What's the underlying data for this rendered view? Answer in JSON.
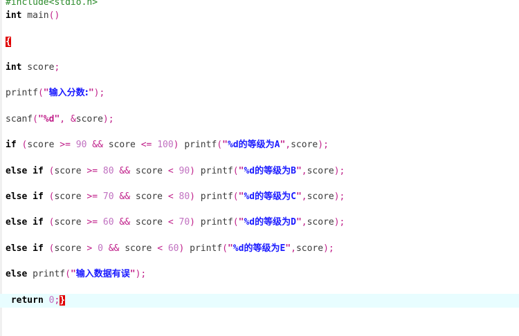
{
  "editor": {
    "lines": [
      [
        {
          "t": "prep",
          "s": "#include<stdio.h>"
        }
      ],
      [
        {
          "t": "kw",
          "s": "int"
        },
        {
          "t": "plain",
          "s": " main"
        },
        {
          "t": "op",
          "s": "()"
        }
      ],
      [
        {
          "t": "brace",
          "s": "{"
        }
      ],
      [
        {
          "t": "kw",
          "s": "int"
        },
        {
          "t": "plain",
          "s": " score"
        },
        {
          "t": "op",
          "s": ";"
        }
      ],
      [
        {
          "t": "plain",
          "s": "printf"
        },
        {
          "t": "op",
          "s": "("
        },
        {
          "t": "str",
          "s": "\""
        },
        {
          "t": "cjk",
          "s": "输入分数:"
        },
        {
          "t": "str",
          "s": "\""
        },
        {
          "t": "op",
          "s": ");"
        }
      ],
      [
        {
          "t": "plain",
          "s": "scanf"
        },
        {
          "t": "op",
          "s": "("
        },
        {
          "t": "str",
          "s": "\"%d\""
        },
        {
          "t": "op",
          "s": ","
        },
        {
          "t": "plain",
          "s": " "
        },
        {
          "t": "op",
          "s": "&"
        },
        {
          "t": "plain",
          "s": "score"
        },
        {
          "t": "op",
          "s": ");"
        }
      ],
      [
        {
          "t": "kw",
          "s": "if"
        },
        {
          "t": "plain",
          "s": " "
        },
        {
          "t": "op",
          "s": "("
        },
        {
          "t": "plain",
          "s": "score "
        },
        {
          "t": "op",
          "s": ">="
        },
        {
          "t": "plain",
          "s": " "
        },
        {
          "t": "num",
          "s": "90"
        },
        {
          "t": "plain",
          "s": " "
        },
        {
          "t": "op",
          "s": "&&"
        },
        {
          "t": "plain",
          "s": " score "
        },
        {
          "t": "op",
          "s": "<="
        },
        {
          "t": "plain",
          "s": " "
        },
        {
          "t": "num",
          "s": "100"
        },
        {
          "t": "op",
          "s": ")"
        },
        {
          "t": "plain",
          "s": " printf"
        },
        {
          "t": "op",
          "s": "("
        },
        {
          "t": "str",
          "s": "\""
        },
        {
          "t": "fmt",
          "s": "%d"
        },
        {
          "t": "cjk",
          "s": "的等级为"
        },
        {
          "t": "fmt",
          "s": "A"
        },
        {
          "t": "str",
          "s": "\""
        },
        {
          "t": "op",
          "s": ","
        },
        {
          "t": "plain",
          "s": "score"
        },
        {
          "t": "op",
          "s": ");"
        }
      ],
      [
        {
          "t": "kw",
          "s": "else if"
        },
        {
          "t": "plain",
          "s": " "
        },
        {
          "t": "op",
          "s": "("
        },
        {
          "t": "plain",
          "s": "score "
        },
        {
          "t": "op",
          "s": ">="
        },
        {
          "t": "plain",
          "s": " "
        },
        {
          "t": "num",
          "s": "80"
        },
        {
          "t": "plain",
          "s": " "
        },
        {
          "t": "op",
          "s": "&&"
        },
        {
          "t": "plain",
          "s": " score "
        },
        {
          "t": "op",
          "s": "<"
        },
        {
          "t": "plain",
          "s": " "
        },
        {
          "t": "num",
          "s": "90"
        },
        {
          "t": "op",
          "s": ")"
        },
        {
          "t": "plain",
          "s": " printf"
        },
        {
          "t": "op",
          "s": "("
        },
        {
          "t": "str",
          "s": "\""
        },
        {
          "t": "fmt",
          "s": "%d"
        },
        {
          "t": "cjk",
          "s": "的等级为"
        },
        {
          "t": "fmt",
          "s": "B"
        },
        {
          "t": "str",
          "s": "\""
        },
        {
          "t": "op",
          "s": ","
        },
        {
          "t": "plain",
          "s": "score"
        },
        {
          "t": "op",
          "s": ");"
        }
      ],
      [
        {
          "t": "kw",
          "s": "else if"
        },
        {
          "t": "plain",
          "s": " "
        },
        {
          "t": "op",
          "s": "("
        },
        {
          "t": "plain",
          "s": "score "
        },
        {
          "t": "op",
          "s": ">="
        },
        {
          "t": "plain",
          "s": " "
        },
        {
          "t": "num",
          "s": "70"
        },
        {
          "t": "plain",
          "s": " "
        },
        {
          "t": "op",
          "s": "&&"
        },
        {
          "t": "plain",
          "s": " score "
        },
        {
          "t": "op",
          "s": "<"
        },
        {
          "t": "plain",
          "s": " "
        },
        {
          "t": "num",
          "s": "80"
        },
        {
          "t": "op",
          "s": ")"
        },
        {
          "t": "plain",
          "s": " printf"
        },
        {
          "t": "op",
          "s": "("
        },
        {
          "t": "str",
          "s": "\""
        },
        {
          "t": "fmt",
          "s": "%d"
        },
        {
          "t": "cjk",
          "s": "的等级为"
        },
        {
          "t": "fmt",
          "s": "C"
        },
        {
          "t": "str",
          "s": "\""
        },
        {
          "t": "op",
          "s": ","
        },
        {
          "t": "plain",
          "s": "score"
        },
        {
          "t": "op",
          "s": ");"
        }
      ],
      [
        {
          "t": "kw",
          "s": "else if"
        },
        {
          "t": "plain",
          "s": " "
        },
        {
          "t": "op",
          "s": "("
        },
        {
          "t": "plain",
          "s": "score "
        },
        {
          "t": "op",
          "s": ">="
        },
        {
          "t": "plain",
          "s": " "
        },
        {
          "t": "num",
          "s": "60"
        },
        {
          "t": "plain",
          "s": " "
        },
        {
          "t": "op",
          "s": "&&"
        },
        {
          "t": "plain",
          "s": " score "
        },
        {
          "t": "op",
          "s": "<"
        },
        {
          "t": "plain",
          "s": " "
        },
        {
          "t": "num",
          "s": "70"
        },
        {
          "t": "op",
          "s": ")"
        },
        {
          "t": "plain",
          "s": " printf"
        },
        {
          "t": "op",
          "s": "("
        },
        {
          "t": "str",
          "s": "\""
        },
        {
          "t": "fmt",
          "s": "%d"
        },
        {
          "t": "cjk",
          "s": "的等级为"
        },
        {
          "t": "fmt",
          "s": "D"
        },
        {
          "t": "str",
          "s": "\""
        },
        {
          "t": "op",
          "s": ","
        },
        {
          "t": "plain",
          "s": "score"
        },
        {
          "t": "op",
          "s": ");"
        }
      ],
      [
        {
          "t": "kw",
          "s": "else if"
        },
        {
          "t": "plain",
          "s": " "
        },
        {
          "t": "op",
          "s": "("
        },
        {
          "t": "plain",
          "s": "score "
        },
        {
          "t": "op",
          "s": ">"
        },
        {
          "t": "plain",
          "s": " "
        },
        {
          "t": "num",
          "s": "0"
        },
        {
          "t": "plain",
          "s": " "
        },
        {
          "t": "op",
          "s": "&&"
        },
        {
          "t": "plain",
          "s": " score "
        },
        {
          "t": "op",
          "s": "<"
        },
        {
          "t": "plain",
          "s": " "
        },
        {
          "t": "num",
          "s": "60"
        },
        {
          "t": "op",
          "s": ")"
        },
        {
          "t": "plain",
          "s": " printf"
        },
        {
          "t": "op",
          "s": "("
        },
        {
          "t": "str",
          "s": "\""
        },
        {
          "t": "fmt",
          "s": "%d"
        },
        {
          "t": "cjk",
          "s": "的等级为"
        },
        {
          "t": "fmt",
          "s": "E"
        },
        {
          "t": "str",
          "s": "\""
        },
        {
          "t": "op",
          "s": ","
        },
        {
          "t": "plain",
          "s": "score"
        },
        {
          "t": "op",
          "s": ");"
        }
      ],
      [
        {
          "t": "kw",
          "s": "else"
        },
        {
          "t": "plain",
          "s": " printf"
        },
        {
          "t": "op",
          "s": "("
        },
        {
          "t": "str",
          "s": "\""
        },
        {
          "t": "cjk",
          "s": "输入数据有误"
        },
        {
          "t": "str",
          "s": "\""
        },
        {
          "t": "op",
          "s": ");"
        }
      ],
      [
        {
          "t": "plain",
          "s": " "
        },
        {
          "t": "kw",
          "s": "return"
        },
        {
          "t": "plain",
          "s": " "
        },
        {
          "t": "num",
          "s": "0"
        },
        {
          "t": "op",
          "s": ";"
        },
        {
          "t": "brace",
          "s": "}"
        }
      ]
    ],
    "current_line": 12,
    "colors": {
      "current_line_bg": "#e8fdff",
      "brace_highlight": "#e00000",
      "keyword": "#000000",
      "operator": "#c0208a",
      "number": "#c070c0",
      "cjk_string": "#1a1aff",
      "preprocessor": "#2a8a2a"
    }
  }
}
